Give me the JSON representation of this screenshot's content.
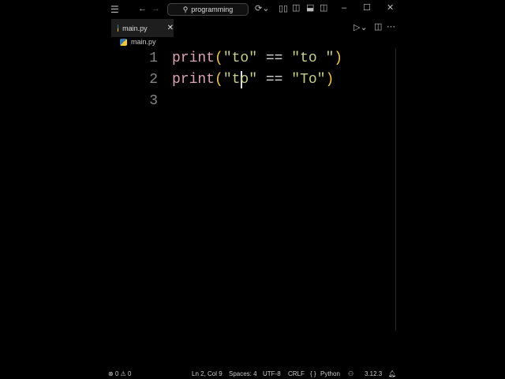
{
  "titlebar": {
    "search_text": "programming"
  },
  "tabs": [
    {
      "label": "main.py"
    }
  ],
  "breadcrumb": {
    "file": "main.py"
  },
  "editor": {
    "lines": [
      {
        "number": "1",
        "tokens": [
          {
            "t": "print",
            "c": "kw"
          },
          {
            "t": "(",
            "c": "par"
          },
          {
            "t": "\"to\"",
            "c": "str"
          },
          {
            "t": " == ",
            "c": "op"
          },
          {
            "t": "\"to \"",
            "c": "str"
          },
          {
            "t": ")",
            "c": "par"
          }
        ]
      },
      {
        "number": "2",
        "tokens": [
          {
            "t": "print",
            "c": "kw"
          },
          {
            "t": "(",
            "c": "par"
          },
          {
            "t": "\"to\"",
            "c": "str"
          },
          {
            "t": " == ",
            "c": "op"
          },
          {
            "t": "\"To\"",
            "c": "str"
          },
          {
            "t": ")",
            "c": "par"
          }
        ]
      },
      {
        "number": "3",
        "tokens": []
      }
    ]
  },
  "status": {
    "errors": "0",
    "warnings": "0",
    "position": "Ln 2, Col 9",
    "spaces": "Spaces: 4",
    "encoding": "UTF-8",
    "eol": "CRLF",
    "language": "Python",
    "language_icon": "{ }",
    "version": "3.12.3"
  }
}
